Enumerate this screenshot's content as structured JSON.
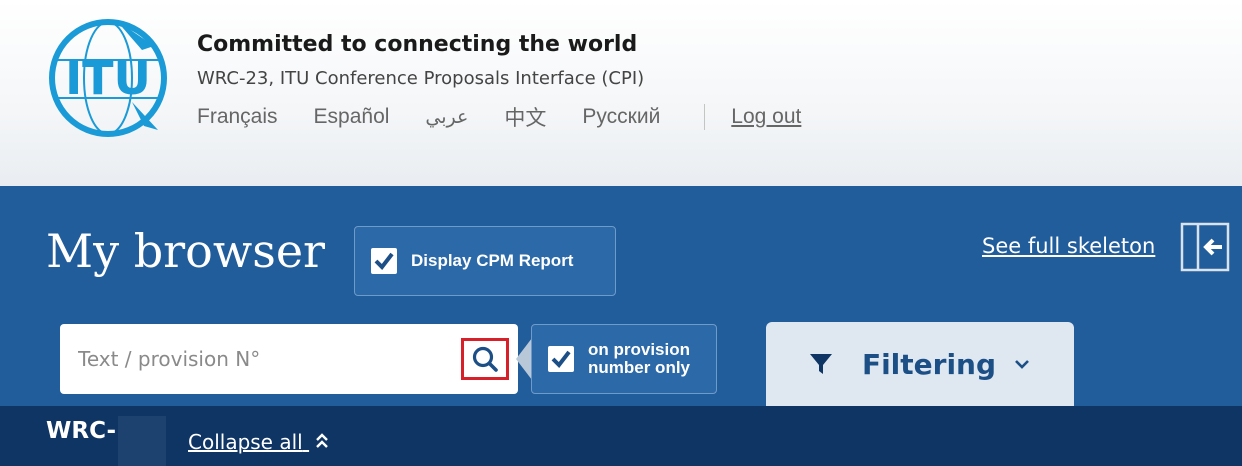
{
  "header": {
    "tagline": "Committed to connecting the world",
    "subtitle": "WRC-23, ITU Conference Proposals Interface (CPI)",
    "languages": [
      "Français",
      "Español",
      "عربي",
      "中文",
      "Русский"
    ],
    "logout": "Log out",
    "logo_text": "ITU",
    "icon": "itu-logo-icon"
  },
  "browser": {
    "title": "My browser",
    "cpm_label": "Display CPM Report",
    "skeleton_link": "See full skeleton",
    "search_placeholder": "Text / provision N°",
    "provision_label_line1": "on provision",
    "provision_label_line2": "number only",
    "filter_label": "Filtering"
  },
  "tree": {
    "wrc_label": "WRC-",
    "collapse_label": "Collapse all"
  },
  "colors": {
    "panel_blue": "#215c9b",
    "dark_bar": "#0f3564",
    "filter_tab": "#dfe8f1",
    "filter_text": "#1d4f87",
    "logo_blue": "#1a9ad6",
    "search_highlight": "#d6202a"
  },
  "icons": [
    "checkbox-checked-icon",
    "search-icon",
    "clear-icon",
    "sidebar-collapse-icon",
    "filter-funnel-icon",
    "chevron-down-icon",
    "double-chevron-up-icon"
  ]
}
